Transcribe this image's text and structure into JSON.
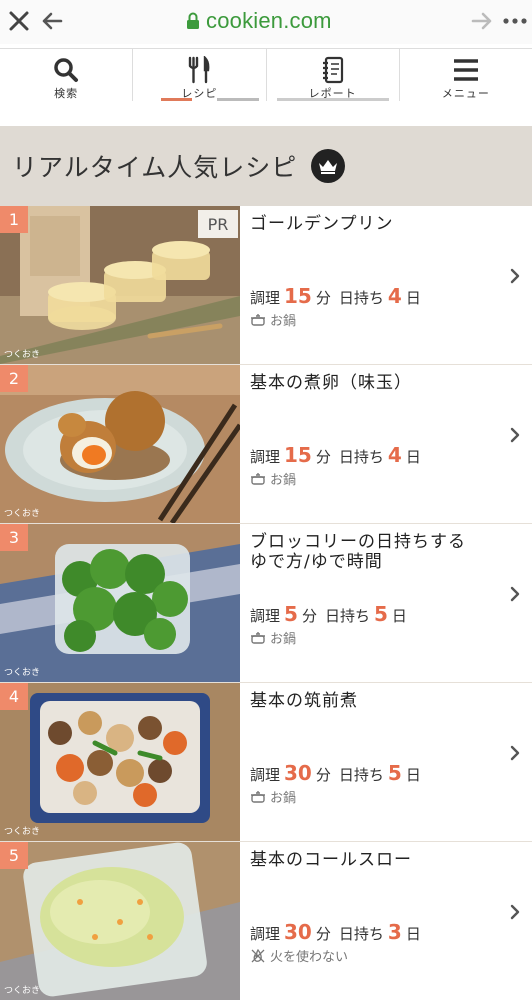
{
  "browser": {
    "url": "cookien.com",
    "close_icon": "close-icon",
    "back_icon": "arrow-left-icon",
    "forward_icon": "arrow-right-icon",
    "more_icon": "more-horizontal-icon",
    "lock_icon": "lock-icon"
  },
  "nav": {
    "items": [
      {
        "label": "検索",
        "icon": "search-icon"
      },
      {
        "label": "レシピ",
        "icon": "fork-knife-icon"
      },
      {
        "label": "レポート",
        "icon": "notebook-icon"
      },
      {
        "label": "メニュー",
        "icon": "hamburger-menu-icon"
      }
    ]
  },
  "section": {
    "title": "リアルタイム人気レシピ",
    "icon": "crown-icon"
  },
  "recipes": [
    {
      "rank": "1",
      "pr": "PR",
      "name": "ゴールデンプリン",
      "name2": "",
      "cook_label": "調理",
      "cook": "15",
      "unit": "分",
      "keep_label": "日持ち",
      "keep": "4",
      "keep_unit": "日",
      "tag": "お鍋",
      "tag_icon": "pot-icon",
      "watermark": "つくおき"
    },
    {
      "rank": "2",
      "pr": "",
      "name": "基本の煮卵（味玉）",
      "name2": "",
      "cook_label": "調理",
      "cook": "15",
      "unit": "分",
      "keep_label": "日持ち",
      "keep": "4",
      "keep_unit": "日",
      "tag": "お鍋",
      "tag_icon": "pot-icon",
      "watermark": "つくおき"
    },
    {
      "rank": "3",
      "pr": "",
      "name": "ブロッコリーの日持ちする",
      "name2": "ゆで方/ゆで時間",
      "cook_label": "調理",
      "cook": "5",
      "unit": "分",
      "keep_label": "日持ち",
      "keep": "5",
      "keep_unit": "日",
      "tag": "お鍋",
      "tag_icon": "pot-icon",
      "watermark": "つくおき"
    },
    {
      "rank": "4",
      "pr": "",
      "name": "基本の筑前煮",
      "name2": "",
      "cook_label": "調理",
      "cook": "30",
      "unit": "分",
      "keep_label": "日持ち",
      "keep": "5",
      "keep_unit": "日",
      "tag": "お鍋",
      "tag_icon": "pot-icon",
      "watermark": "つくおき"
    },
    {
      "rank": "5",
      "pr": "",
      "name": "基本のコールスロー",
      "name2": "",
      "cook_label": "調理",
      "cook": "30",
      "unit": "分",
      "keep_label": "日持ち",
      "keep": "3",
      "keep_unit": "日",
      "tag": "火を使わない",
      "tag_icon": "no-fire-icon",
      "watermark": "つくおき"
    }
  ]
}
